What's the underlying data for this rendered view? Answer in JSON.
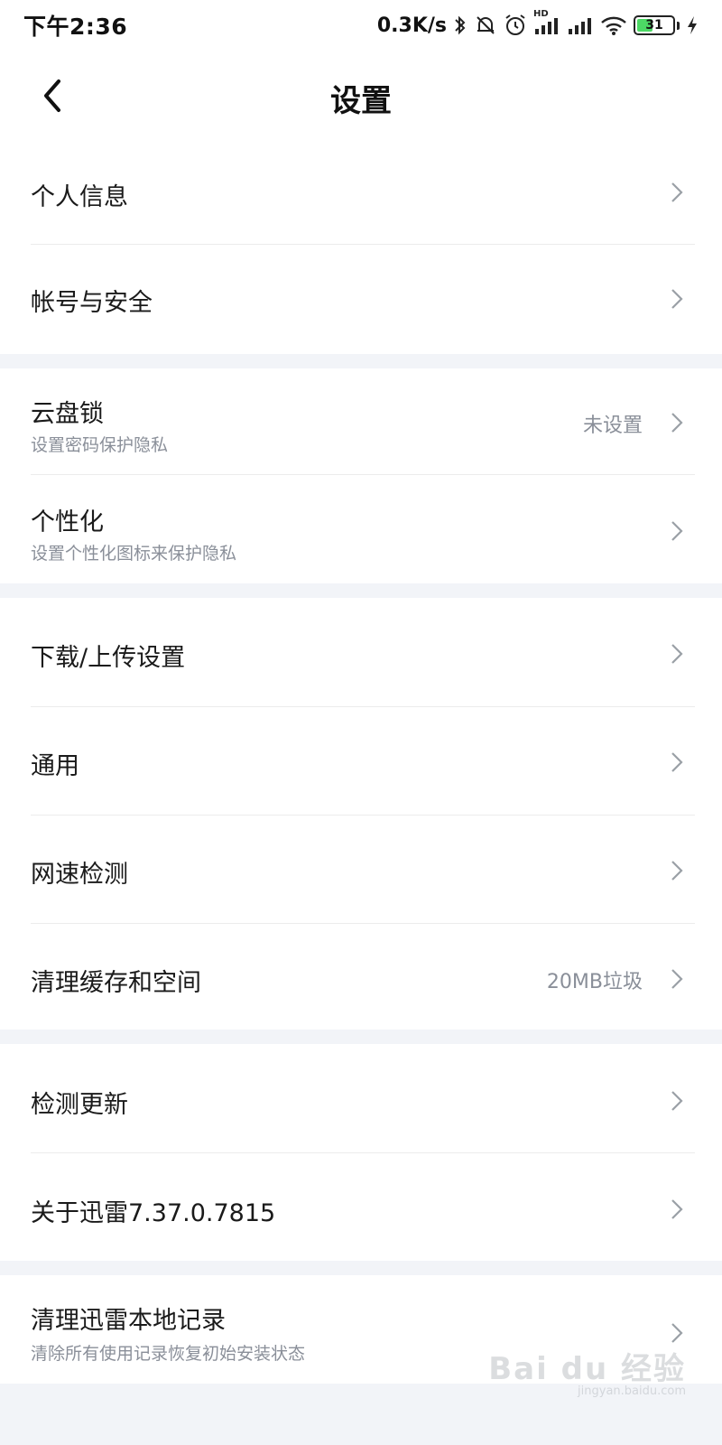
{
  "status_bar": {
    "time": "下午2:36",
    "net_speed": "0.3K/s",
    "signal_hd_label": "HD",
    "battery_level": "31"
  },
  "header": {
    "title": "设置"
  },
  "groups": [
    {
      "items": [
        {
          "title": "个人信息"
        },
        {
          "title": "帐号与安全"
        }
      ]
    },
    {
      "items": [
        {
          "title": "云盘锁",
          "subtitle": "设置密码保护隐私",
          "value": "未设置"
        },
        {
          "title": "个性化",
          "subtitle": "设置个性化图标来保护隐私"
        }
      ]
    },
    {
      "items": [
        {
          "title": "下载/上传设置"
        },
        {
          "title": "通用"
        },
        {
          "title": "网速检测"
        },
        {
          "title": "清理缓存和空间",
          "value": "20MB垃圾"
        }
      ]
    },
    {
      "items": [
        {
          "title": "检测更新"
        },
        {
          "title": "关于迅雷7.37.0.7815"
        }
      ]
    },
    {
      "items": [
        {
          "title": "清理迅雷本地记录",
          "subtitle": "清除所有使用记录恢复初始安装状态"
        }
      ]
    }
  ],
  "watermark": {
    "main": "Bai du 经验",
    "sub": "jingyan.baidu.com"
  },
  "colors": {
    "background": "#f2f4f8",
    "card": "#ffffff",
    "secondary_text": "#8a8f99",
    "battery_fill": "#4cd964"
  },
  "icons": [
    "back-arrow-icon",
    "chevron-right-icon",
    "bluetooth-icon",
    "mute-bell-icon",
    "alarm-icon",
    "signal-icon",
    "wifi-icon",
    "battery-icon",
    "charging-icon"
  ]
}
